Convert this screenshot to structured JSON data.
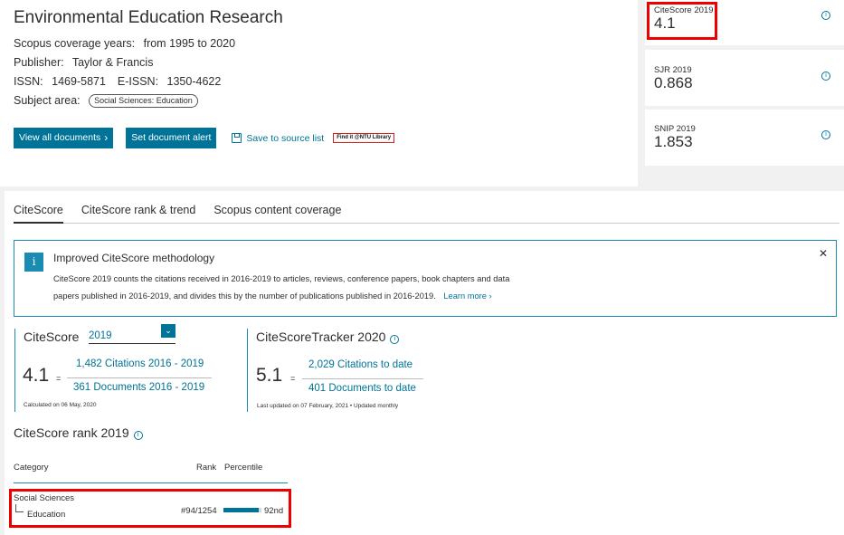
{
  "journal": {
    "title": "Environmental Education Research",
    "coverage_label": "Scopus coverage years:",
    "coverage_value": "from 1995 to 2020",
    "publisher_label": "Publisher:",
    "publisher_value": "Taylor & Francis",
    "issn_label": "ISSN:",
    "issn_value": "1469-5871",
    "eissn_label": "E-ISSN:",
    "eissn_value": "1350-4622",
    "subject_label": "Subject area:",
    "subject_chip": "Social Sciences: Education"
  },
  "actions": {
    "view_all": "View all documents",
    "set_alert": "Set document alert",
    "save_source": "Save to source list",
    "ntu_link": "Find it @NTU Library"
  },
  "metrics": [
    {
      "label": "CiteScore 2019",
      "value": "4.1"
    },
    {
      "label": "SJR 2019",
      "value": "0.868"
    },
    {
      "label": "SNIP 2019",
      "value": "1.853"
    }
  ],
  "tabs": [
    "CiteScore",
    "CiteScore rank & trend",
    "Scopus content coverage"
  ],
  "notice": {
    "title": "Improved CiteScore methodology",
    "body": "CiteScore 2019 counts the citations received in 2016-2019 to articles, reviews, conference papers, book chapters and data papers published in 2016-2019, and divides this by the number of publications published in 2016-2019.",
    "learn_more": "Learn more"
  },
  "citescore": {
    "heading": "CiteScore",
    "year": "2019",
    "value": "4.1",
    "eq": "=",
    "citations": "1,482 Citations 2016 - 2019",
    "documents": "361 Documents 2016 - 2019",
    "note": "Calculated on 06 May, 2020"
  },
  "tracker": {
    "heading": "CiteScoreTracker 2020",
    "value": "5.1",
    "eq": "=",
    "citations": "2,029 Citations to date",
    "documents": "401 Documents to date",
    "note": "Last updated on 07 February, 2021 • Updated monthly"
  },
  "rank": {
    "heading": "CiteScore rank 2019",
    "col_category": "Category",
    "col_rank": "Rank",
    "col_percentile": "Percentile",
    "rows": [
      {
        "category": "Social Sciences",
        "subcategory": "Education",
        "rank": "#94/1254",
        "percentile": "92nd",
        "percentile_value": 92
      }
    ]
  },
  "colors": {
    "accent": "#007398",
    "border_accent": "#1a8bb3",
    "highlight": "#e00000"
  }
}
